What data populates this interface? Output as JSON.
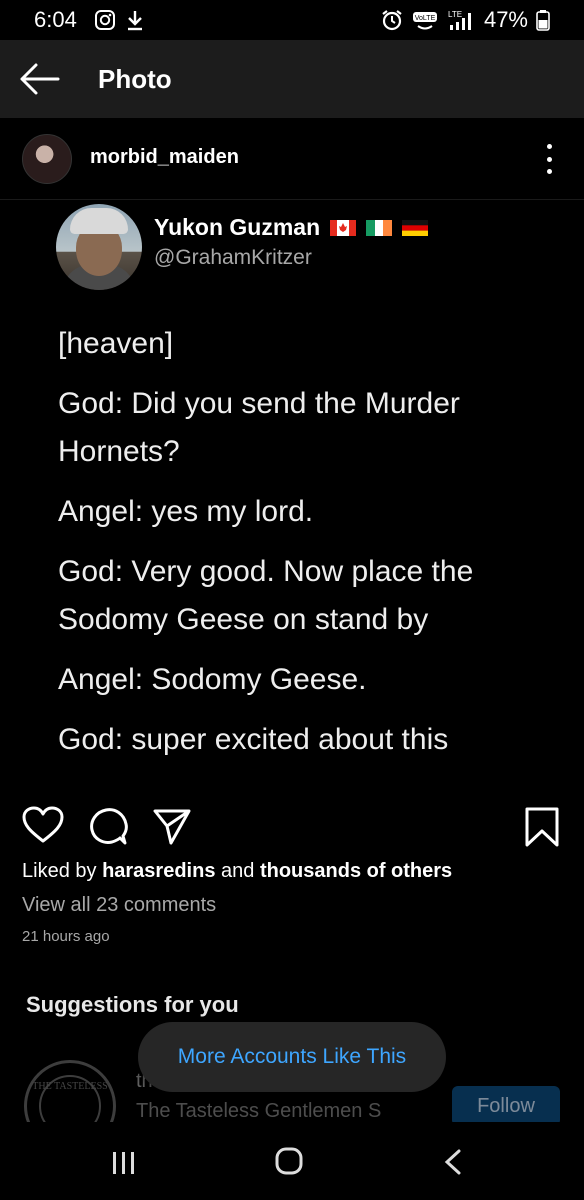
{
  "status_bar": {
    "time": "6:04",
    "battery": "47%",
    "icons": [
      "instagram-icon",
      "download-icon",
      "alarm-icon",
      "volte-icon",
      "lte-signal-icon",
      "battery-icon"
    ]
  },
  "header": {
    "title": "Photo"
  },
  "post": {
    "username": "morbid_maiden",
    "tweet": {
      "name": "Yukon Guzman",
      "flags": [
        "canada-flag",
        "ireland-flag",
        "germany-flag"
      ],
      "handle": "@GrahamKritzer",
      "lines": [
        "[heaven]",
        "God: Did you send the Murder Hornets?",
        "Angel: yes my lord.",
        "God: Very good. Now place the Sodomy Geese on stand by",
        "Angel: Sodomy Geese.",
        "God: super excited about this"
      ]
    },
    "likes": {
      "prefix": "Liked by",
      "user": "harasredins",
      "middle": "and",
      "suffix": "thousands of others"
    },
    "view_comments": "View all 23 comments",
    "time_ago": "21 hours ago"
  },
  "suggestions": {
    "title": "Suggestions for you",
    "account_name": "th",
    "account_sub": "The Tasteless Gentlemen S",
    "follow_label": "Follow",
    "badge_text": "THE TASTELESS"
  },
  "toast": {
    "label": "More Accounts Like This"
  },
  "colors": {
    "accent": "#3ea6ff",
    "header_bg": "#1c1c1c",
    "background": "#000000",
    "muted": "#a8a8a8"
  }
}
